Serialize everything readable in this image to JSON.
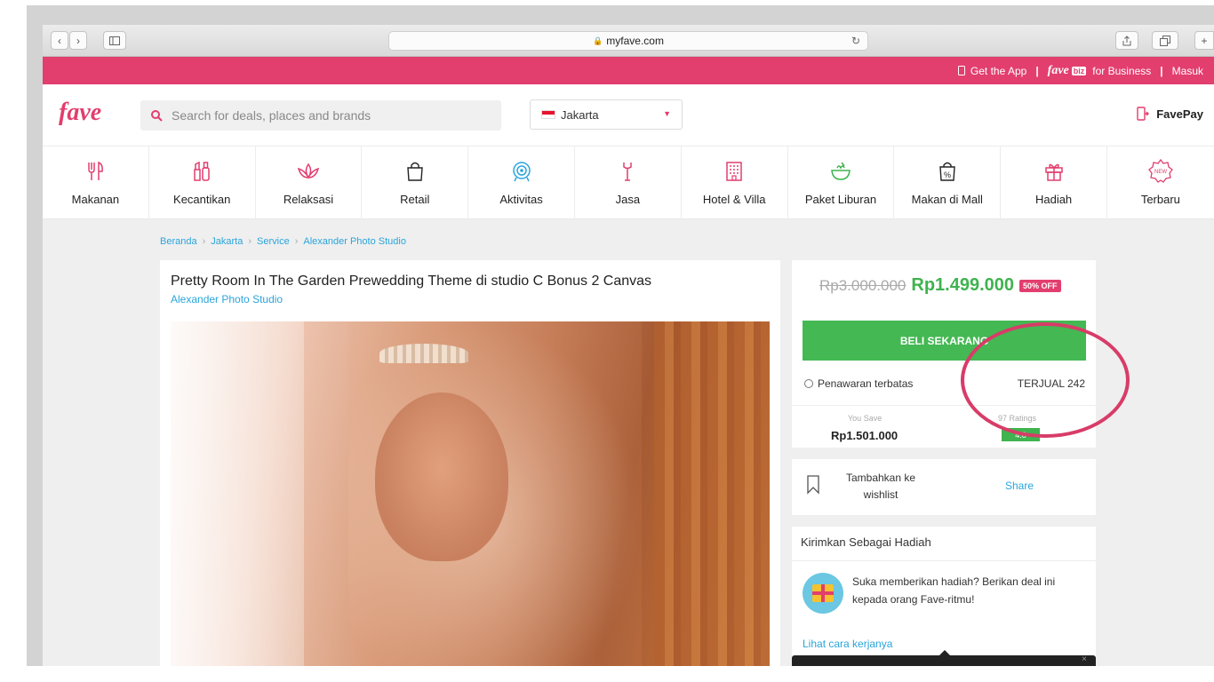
{
  "browser": {
    "url": "myfave.com"
  },
  "topbar": {
    "get_app": "Get the App",
    "favebiz_brand": "fave",
    "favebiz_badge": "biz",
    "for_business": "for Business",
    "login": "Masuk"
  },
  "header": {
    "logo": "fave",
    "search_placeholder": "Search for deals, places and brands",
    "city": "Jakarta",
    "favepay": "FavePay"
  },
  "categories": [
    {
      "label": "Makanan",
      "icon": "utensils-icon"
    },
    {
      "label": "Kecantikan",
      "icon": "cosmetics-icon"
    },
    {
      "label": "Relaksasi",
      "icon": "lotus-icon"
    },
    {
      "label": "Retail",
      "icon": "shopping-bag-icon"
    },
    {
      "label": "Aktivitas",
      "icon": "target-icon"
    },
    {
      "label": "Jasa",
      "icon": "wrench-icon"
    },
    {
      "label": "Hotel & Villa",
      "icon": "building-icon"
    },
    {
      "label": "Paket Liburan",
      "icon": "food-bowl-icon"
    },
    {
      "label": "Makan di Mall",
      "icon": "discount-bag-icon"
    },
    {
      "label": "Hadiah",
      "icon": "gift-icon"
    },
    {
      "label": "Terbaru",
      "icon": "new-badge-icon",
      "badge": "NEW"
    }
  ],
  "breadcrumb": [
    "Beranda",
    "Jakarta",
    "Service",
    "Alexander Photo Studio"
  ],
  "deal": {
    "title": "Pretty Room In The Garden Prewedding Theme di studio C Bonus 2 Canvas",
    "merchant": "Alexander Photo Studio"
  },
  "pricing": {
    "original": "Rp3.000.000",
    "price": "Rp1.499.000",
    "discount": "50% OFF",
    "buy_button": "BELI SEKARANG",
    "limited": "Penawaran terbatas",
    "sold": "TERJUAL 242",
    "you_save_label": "You Save",
    "you_save_value": "Rp1.501.000",
    "ratings_label": "97 Ratings",
    "rating_value": "4.8"
  },
  "wishlist": {
    "label": "Tambahkan ke wishlist",
    "share": "Share"
  },
  "gift": {
    "title": "Kirimkan Sebagai Hadiah",
    "text": "Suka memberikan hadiah? Berikan deal ini kepada orang Fave-ritmu!",
    "how_link": "Lihat cara kerjanya"
  },
  "colors": {
    "brand": "#e23e6e",
    "buy_green": "#44b853",
    "link_blue": "#2aa5db",
    "annotation": "#d83c68"
  }
}
